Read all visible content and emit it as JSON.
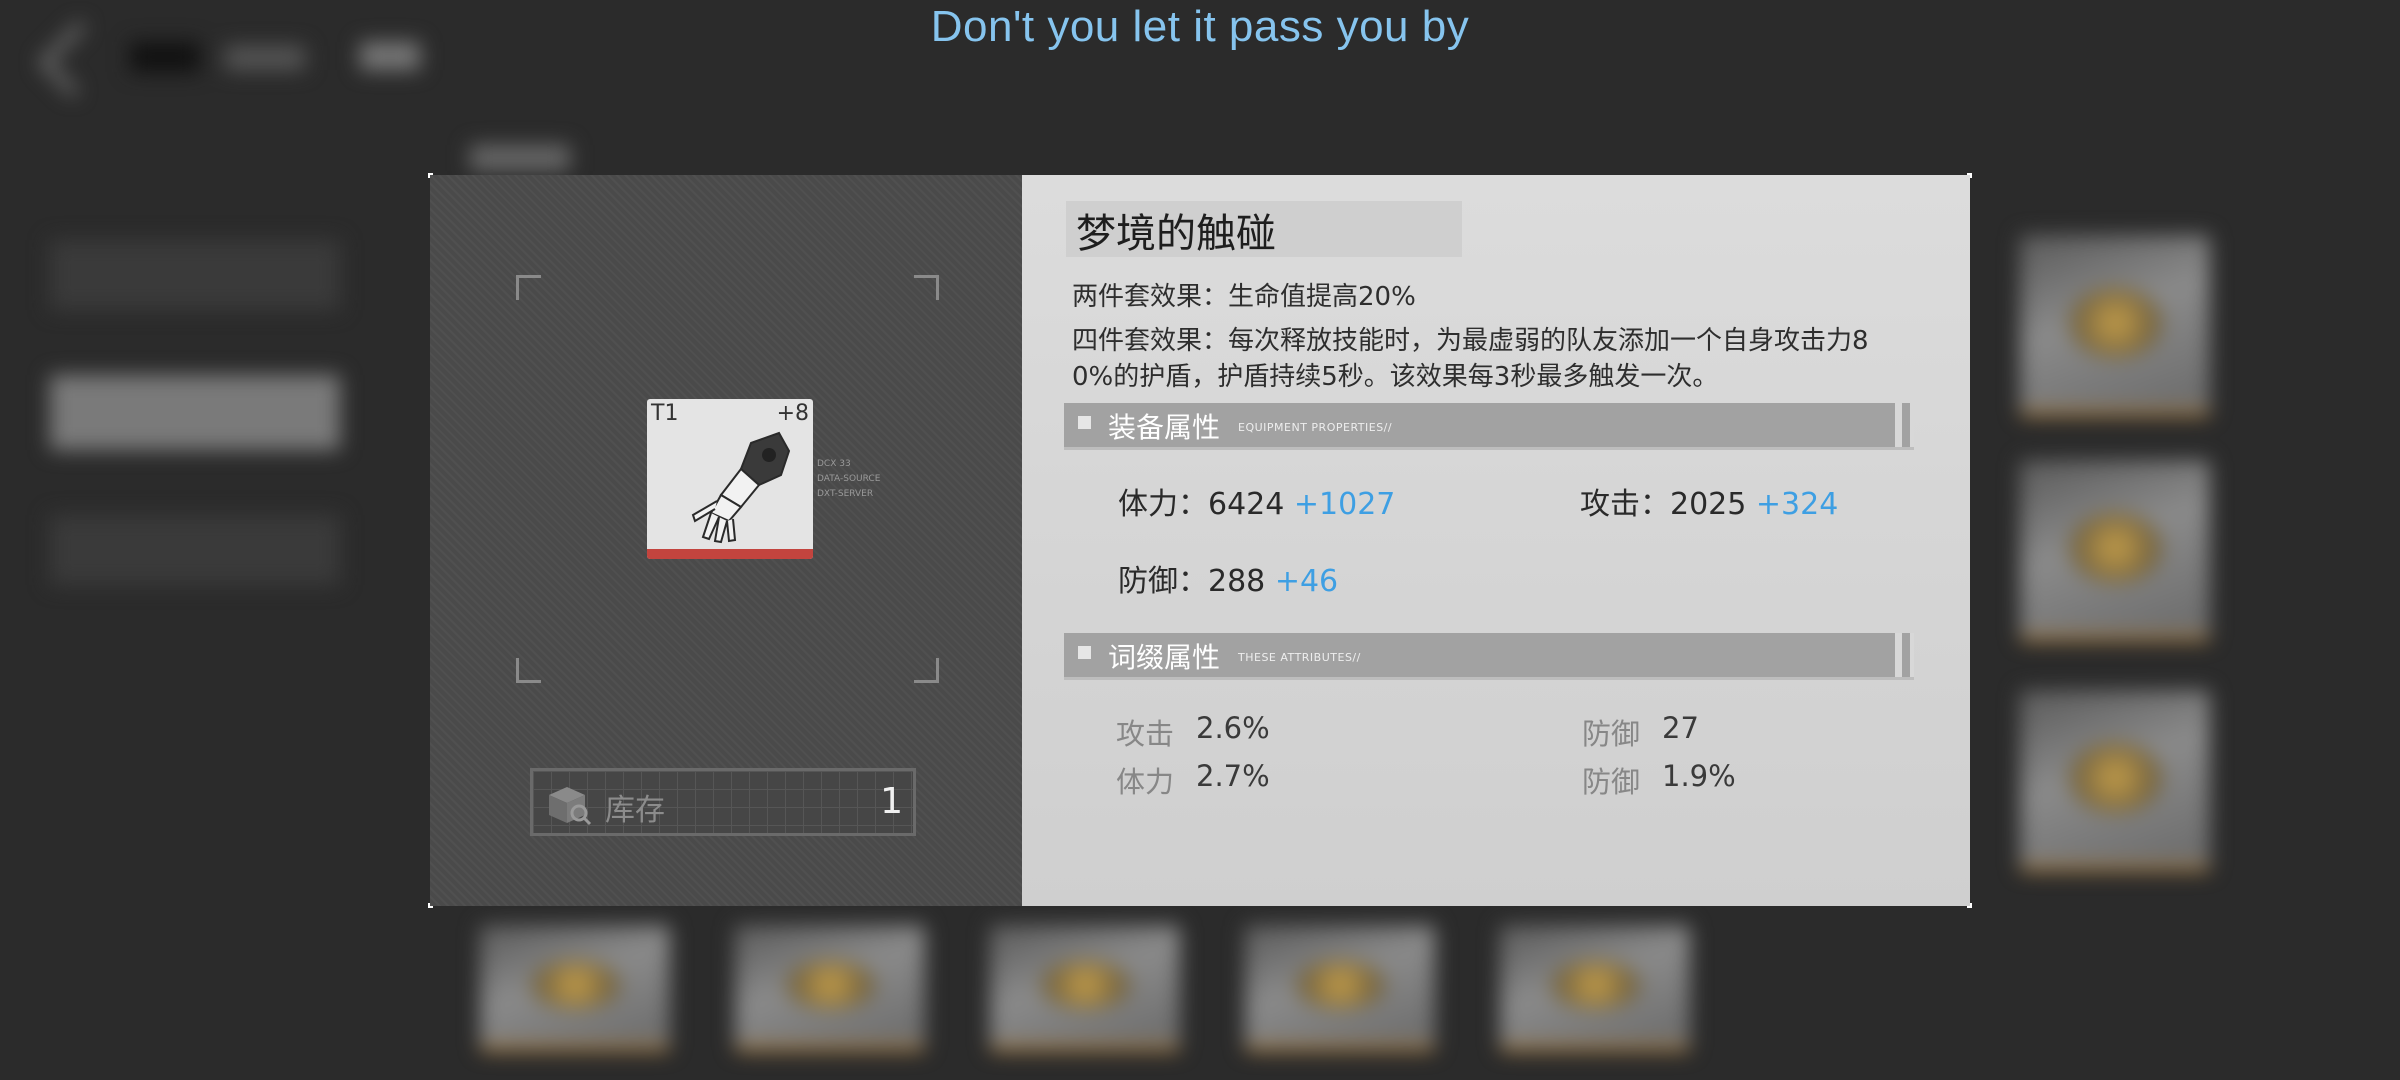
{
  "caption": "Don't you let it pass you by",
  "colors": {
    "accent_blue": "#3e9fe3",
    "caption_blue": "#86c4ee",
    "rarity_bar": "#c3443e"
  },
  "item": {
    "tier": "T1",
    "level": "+8",
    "icon": "mechanical-gauntlet-icon",
    "micro_text": [
      "DCX 33",
      "DATA-SOURCE",
      "DXT-SERVER"
    ]
  },
  "stock": {
    "icon": "box-search-icon",
    "label": "库存",
    "count": "1"
  },
  "set": {
    "name": "梦境的触碰",
    "two_piece": "两件套效果：生命值提高20%",
    "four_piece_line1": "四件套效果：每次释放技能时，为最虚弱的队友添加一个自身攻击力8",
    "four_piece_line2": "0%的护盾，护盾持续5秒。该效果每3秒最多触发一次。"
  },
  "equipment": {
    "title": "装备属性",
    "title_en": "EQUIPMENT PROPERTIES//",
    "stats": [
      {
        "label": "体力：6424",
        "bonus": "+1027"
      },
      {
        "label": "攻击：2025",
        "bonus": "+324"
      },
      {
        "label": "防御：288",
        "bonus": "+46"
      }
    ]
  },
  "affix": {
    "title": "词缀属性",
    "title_en": "THESE ATTRIBUTES//",
    "stats": [
      {
        "key": "攻击",
        "value": "2.6%"
      },
      {
        "key": "防御",
        "value": "27"
      },
      {
        "key": "体力",
        "value": "2.7%"
      },
      {
        "key": "防御",
        "value": "1.9%"
      }
    ]
  }
}
